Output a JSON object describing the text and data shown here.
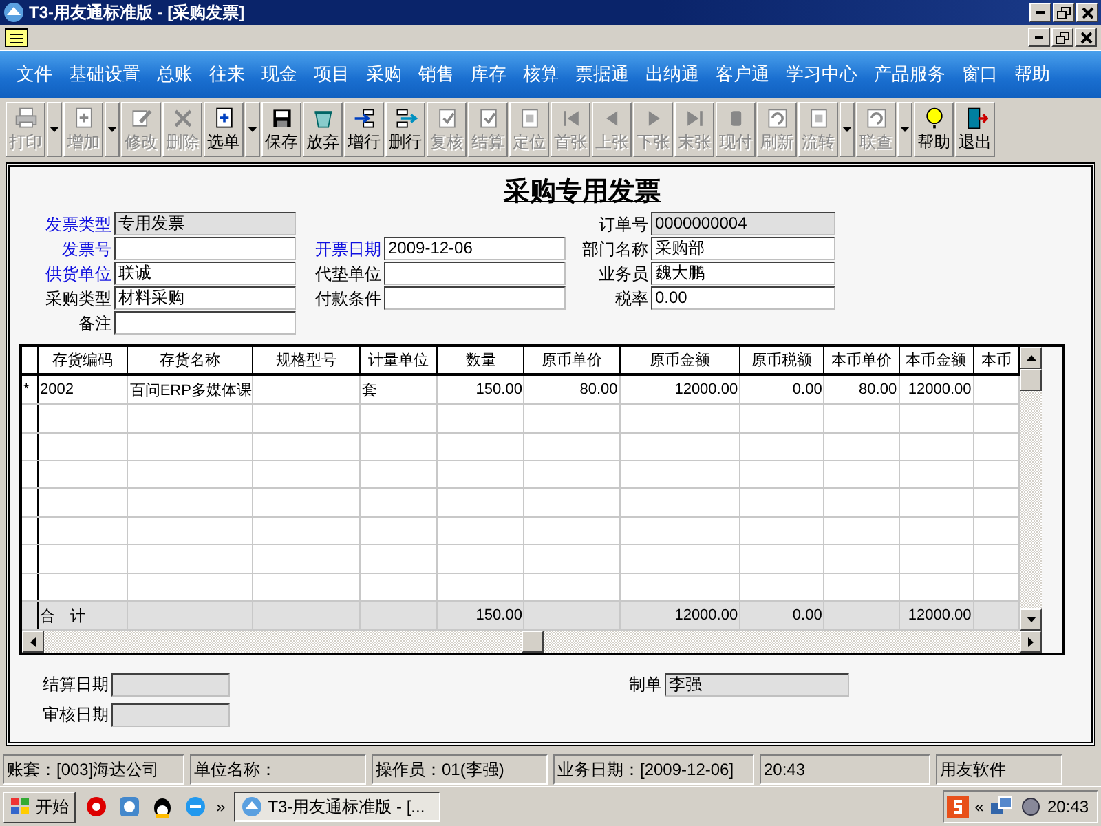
{
  "window": {
    "title": "T3-用友通标准版 - [采购发票]"
  },
  "menu": [
    "文件",
    "基础设置",
    "总账",
    "往来",
    "现金",
    "项目",
    "采购",
    "销售",
    "库存",
    "核算",
    "票据通",
    "出纳通",
    "客户通",
    "学习中心",
    "产品服务",
    "窗口",
    "帮助"
  ],
  "toolbar": [
    {
      "kind": "button",
      "label": "打印",
      "disabled": true
    },
    {
      "kind": "dropdown"
    },
    {
      "kind": "button",
      "label": "增加",
      "disabled": true
    },
    {
      "kind": "dropdown"
    },
    {
      "kind": "button",
      "label": "修改",
      "disabled": true
    },
    {
      "kind": "button",
      "label": "删除",
      "disabled": true
    },
    {
      "kind": "button",
      "label": "选单",
      "disabled": false
    },
    {
      "kind": "dropdown"
    },
    {
      "kind": "button",
      "label": "保存",
      "disabled": false
    },
    {
      "kind": "button",
      "label": "放弃",
      "disabled": false
    },
    {
      "kind": "button",
      "label": "增行",
      "disabled": false
    },
    {
      "kind": "button",
      "label": "删行",
      "disabled": false
    },
    {
      "kind": "button",
      "label": "复核",
      "disabled": true
    },
    {
      "kind": "button",
      "label": "结算",
      "disabled": true
    },
    {
      "kind": "button",
      "label": "定位",
      "disabled": true
    },
    {
      "kind": "button",
      "label": "首张",
      "disabled": true
    },
    {
      "kind": "button",
      "label": "上张",
      "disabled": true
    },
    {
      "kind": "button",
      "label": "下张",
      "disabled": true
    },
    {
      "kind": "button",
      "label": "末张",
      "disabled": true
    },
    {
      "kind": "button",
      "label": "现付",
      "disabled": true
    },
    {
      "kind": "button",
      "label": "刷新",
      "disabled": true
    },
    {
      "kind": "button",
      "label": "流转",
      "disabled": true
    },
    {
      "kind": "dropdown"
    },
    {
      "kind": "button",
      "label": "联查",
      "disabled": true
    },
    {
      "kind": "dropdown"
    },
    {
      "kind": "button",
      "label": "帮助",
      "disabled": false
    },
    {
      "kind": "button",
      "label": "退出",
      "disabled": false
    }
  ],
  "form": {
    "title": "采购专用发票",
    "rows": [
      {
        "left": {
          "label": "发票类型",
          "value": "专用发票",
          "required": true,
          "readonly": true
        },
        "right": {
          "label": "订单号",
          "value": "0000000004",
          "required": false,
          "readonly": true
        }
      },
      {
        "left": {
          "label": "发票号",
          "required": true,
          "readonly": false
        },
        "middle": {
          "label": "开票日期",
          "value": "2009-12-06",
          "required": true,
          "readonly": false
        },
        "right": {
          "label": "部门名称",
          "value": "采购部",
          "required": false,
          "readonly": false
        }
      },
      {
        "left": {
          "label": "供货单位",
          "value": "联诚",
          "required": true,
          "readonly": false
        },
        "middle": {
          "label": "代垫单位",
          "required": false,
          "readonly": false
        },
        "right": {
          "label": "业务员",
          "value": "魏大鹏",
          "required": false,
          "readonly": false
        }
      },
      {
        "left": {
          "label": "采购类型",
          "value": "材料采购",
          "required": false,
          "readonly": false
        },
        "middle": {
          "label": "付款条件",
          "required": false,
          "readonly": false
        },
        "right": {
          "label": "税率",
          "value": "0.00",
          "required": false,
          "readonly": false
        }
      },
      {
        "left": {
          "label": "备注",
          "required": false,
          "readonly": false
        }
      }
    ],
    "table": {
      "columns": [
        {
          "label": "存货编码",
          "kind": "text"
        },
        {
          "label": "存货名称",
          "kind": "text"
        },
        {
          "label": "规格型号",
          "kind": "text"
        },
        {
          "label": "计量单位",
          "kind": "text"
        },
        {
          "label": "数量",
          "kind": "number"
        },
        {
          "label": "原币单价",
          "kind": "number"
        },
        {
          "label": "原币金额",
          "kind": "number"
        },
        {
          "label": "原币税额",
          "kind": "number"
        },
        {
          "label": "本币单价",
          "kind": "number"
        },
        {
          "label": "本币金额",
          "kind": "number"
        },
        {
          "label": "本币",
          "kind": "number"
        }
      ],
      "rows": [
        {
          "marker": "*",
          "cells": [
            "2002",
            "百问ERP多媒体课",
            null,
            "套",
            "150.00",
            "80.00",
            "12000.00",
            "0.00",
            "80.00",
            "12000.00",
            null
          ]
        }
      ],
      "total": {
        "label": "合　计",
        "cells": [
          null,
          null,
          null,
          "150.00",
          null,
          "12000.00",
          "0.00",
          null,
          "12000.00",
          null
        ]
      }
    },
    "footer": {
      "left": [
        {
          "label": "结算日期",
          "readonly": true
        },
        {
          "label": "审核日期",
          "readonly": true
        }
      ],
      "right": [
        {
          "label": "制单",
          "value": "李强",
          "readonly": true
        }
      ]
    }
  },
  "status_bar": [
    "账套：[003]海达公司",
    "单位名称：",
    "操作员：01(李强)",
    "业务日期：[2009-12-06]",
    "20:43",
    "用友软件"
  ],
  "taskbar": {
    "start": "开始",
    "more": "»",
    "task": "T3-用友通标准版 - [...",
    "tray_more": "«",
    "clock": "20:43"
  }
}
